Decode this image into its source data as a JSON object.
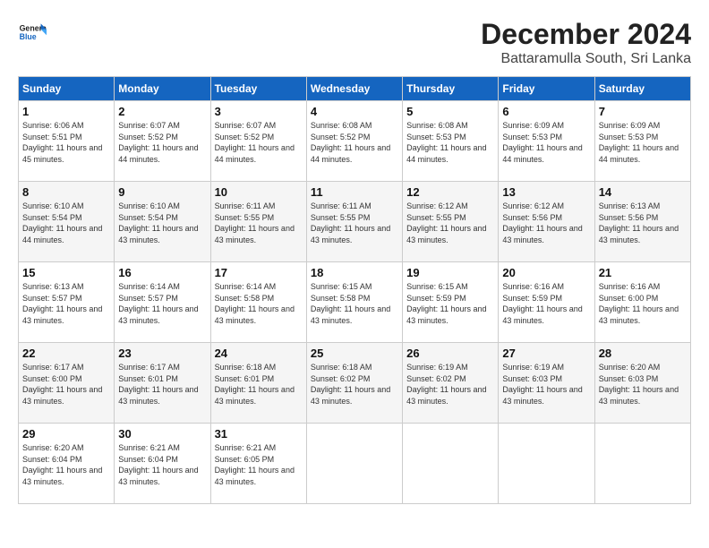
{
  "header": {
    "logo_general": "General",
    "logo_blue": "Blue",
    "title": "December 2024",
    "subtitle": "Battaramulla South, Sri Lanka"
  },
  "weekdays": [
    "Sunday",
    "Monday",
    "Tuesday",
    "Wednesday",
    "Thursday",
    "Friday",
    "Saturday"
  ],
  "weeks": [
    [
      {
        "day": "1",
        "sunrise": "6:06 AM",
        "sunset": "5:51 PM",
        "daylight": "11 hours and 45 minutes."
      },
      {
        "day": "2",
        "sunrise": "6:07 AM",
        "sunset": "5:52 PM",
        "daylight": "11 hours and 44 minutes."
      },
      {
        "day": "3",
        "sunrise": "6:07 AM",
        "sunset": "5:52 PM",
        "daylight": "11 hours and 44 minutes."
      },
      {
        "day": "4",
        "sunrise": "6:08 AM",
        "sunset": "5:52 PM",
        "daylight": "11 hours and 44 minutes."
      },
      {
        "day": "5",
        "sunrise": "6:08 AM",
        "sunset": "5:53 PM",
        "daylight": "11 hours and 44 minutes."
      },
      {
        "day": "6",
        "sunrise": "6:09 AM",
        "sunset": "5:53 PM",
        "daylight": "11 hours and 44 minutes."
      },
      {
        "day": "7",
        "sunrise": "6:09 AM",
        "sunset": "5:53 PM",
        "daylight": "11 hours and 44 minutes."
      }
    ],
    [
      {
        "day": "8",
        "sunrise": "6:10 AM",
        "sunset": "5:54 PM",
        "daylight": "11 hours and 44 minutes."
      },
      {
        "day": "9",
        "sunrise": "6:10 AM",
        "sunset": "5:54 PM",
        "daylight": "11 hours and 43 minutes."
      },
      {
        "day": "10",
        "sunrise": "6:11 AM",
        "sunset": "5:55 PM",
        "daylight": "11 hours and 43 minutes."
      },
      {
        "day": "11",
        "sunrise": "6:11 AM",
        "sunset": "5:55 PM",
        "daylight": "11 hours and 43 minutes."
      },
      {
        "day": "12",
        "sunrise": "6:12 AM",
        "sunset": "5:55 PM",
        "daylight": "11 hours and 43 minutes."
      },
      {
        "day": "13",
        "sunrise": "6:12 AM",
        "sunset": "5:56 PM",
        "daylight": "11 hours and 43 minutes."
      },
      {
        "day": "14",
        "sunrise": "6:13 AM",
        "sunset": "5:56 PM",
        "daylight": "11 hours and 43 minutes."
      }
    ],
    [
      {
        "day": "15",
        "sunrise": "6:13 AM",
        "sunset": "5:57 PM",
        "daylight": "11 hours and 43 minutes."
      },
      {
        "day": "16",
        "sunrise": "6:14 AM",
        "sunset": "5:57 PM",
        "daylight": "11 hours and 43 minutes."
      },
      {
        "day": "17",
        "sunrise": "6:14 AM",
        "sunset": "5:58 PM",
        "daylight": "11 hours and 43 minutes."
      },
      {
        "day": "18",
        "sunrise": "6:15 AM",
        "sunset": "5:58 PM",
        "daylight": "11 hours and 43 minutes."
      },
      {
        "day": "19",
        "sunrise": "6:15 AM",
        "sunset": "5:59 PM",
        "daylight": "11 hours and 43 minutes."
      },
      {
        "day": "20",
        "sunrise": "6:16 AM",
        "sunset": "5:59 PM",
        "daylight": "11 hours and 43 minutes."
      },
      {
        "day": "21",
        "sunrise": "6:16 AM",
        "sunset": "6:00 PM",
        "daylight": "11 hours and 43 minutes."
      }
    ],
    [
      {
        "day": "22",
        "sunrise": "6:17 AM",
        "sunset": "6:00 PM",
        "daylight": "11 hours and 43 minutes."
      },
      {
        "day": "23",
        "sunrise": "6:17 AM",
        "sunset": "6:01 PM",
        "daylight": "11 hours and 43 minutes."
      },
      {
        "day": "24",
        "sunrise": "6:18 AM",
        "sunset": "6:01 PM",
        "daylight": "11 hours and 43 minutes."
      },
      {
        "day": "25",
        "sunrise": "6:18 AM",
        "sunset": "6:02 PM",
        "daylight": "11 hours and 43 minutes."
      },
      {
        "day": "26",
        "sunrise": "6:19 AM",
        "sunset": "6:02 PM",
        "daylight": "11 hours and 43 minutes."
      },
      {
        "day": "27",
        "sunrise": "6:19 AM",
        "sunset": "6:03 PM",
        "daylight": "11 hours and 43 minutes."
      },
      {
        "day": "28",
        "sunrise": "6:20 AM",
        "sunset": "6:03 PM",
        "daylight": "11 hours and 43 minutes."
      }
    ],
    [
      {
        "day": "29",
        "sunrise": "6:20 AM",
        "sunset": "6:04 PM",
        "daylight": "11 hours and 43 minutes."
      },
      {
        "day": "30",
        "sunrise": "6:21 AM",
        "sunset": "6:04 PM",
        "daylight": "11 hours and 43 minutes."
      },
      {
        "day": "31",
        "sunrise": "6:21 AM",
        "sunset": "6:05 PM",
        "daylight": "11 hours and 43 minutes."
      },
      null,
      null,
      null,
      null
    ]
  ],
  "labels": {
    "sunrise": "Sunrise:",
    "sunset": "Sunset:",
    "daylight": "Daylight: "
  }
}
